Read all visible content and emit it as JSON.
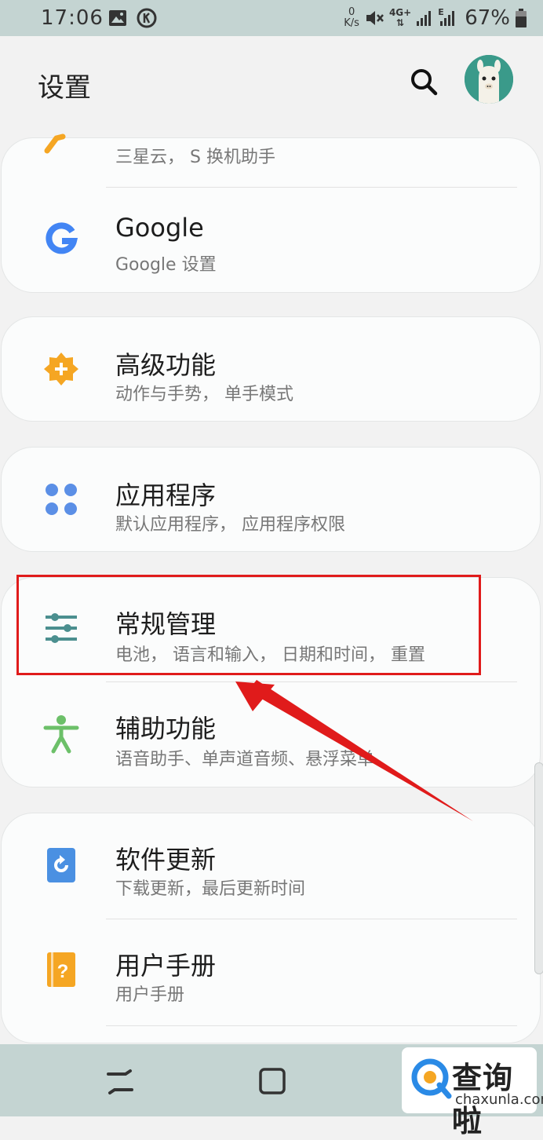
{
  "status_bar": {
    "time": "17:06",
    "network_speed_value": "0",
    "network_speed_unit": "K/s",
    "network_type": "4G+",
    "signal2_label": "E",
    "battery_percent": "67%"
  },
  "header": {
    "title": "设置",
    "search_icon": "search-icon",
    "avatar_icon": "alpaca-avatar"
  },
  "cards": [
    {
      "rows": [
        {
          "title": "",
          "subtitle": "三星云， S 换机助手",
          "icon": "key-icon"
        },
        {
          "title": "Google",
          "subtitle": "Google 设置",
          "icon": "google-icon"
        }
      ]
    },
    {
      "rows": [
        {
          "title": "高级功能",
          "subtitle": "动作与手势， 单手模式",
          "icon": "gear-plus-icon"
        }
      ]
    },
    {
      "rows": [
        {
          "title": "应用程序",
          "subtitle": "默认应用程序， 应用程序权限",
          "icon": "apps-icon"
        }
      ]
    },
    {
      "rows": [
        {
          "title": "常规管理",
          "subtitle": "电池， 语言和输入， 日期和时间， 重置",
          "icon": "sliders-icon"
        },
        {
          "title": "辅助功能",
          "subtitle": "语音助手、单声道音频、悬浮菜单",
          "icon": "accessibility-icon"
        }
      ]
    },
    {
      "rows": [
        {
          "title": "软件更新",
          "subtitle": "下载更新，最后更新时间",
          "icon": "update-icon"
        },
        {
          "title": "用户手册",
          "subtitle": "用户手册",
          "icon": "manual-icon"
        }
      ]
    }
  ],
  "watermark": {
    "name": "查询啦",
    "domain": "chaxunla.com"
  },
  "colors": {
    "status_bar_bg": "#c4d4d2",
    "highlight_red": "#e01b1b",
    "google_blue": "#4285f4",
    "orange": "#f5a623",
    "apps_blue": "#5b8fe6",
    "teal": "#4b8f8f",
    "green": "#6cc069"
  }
}
